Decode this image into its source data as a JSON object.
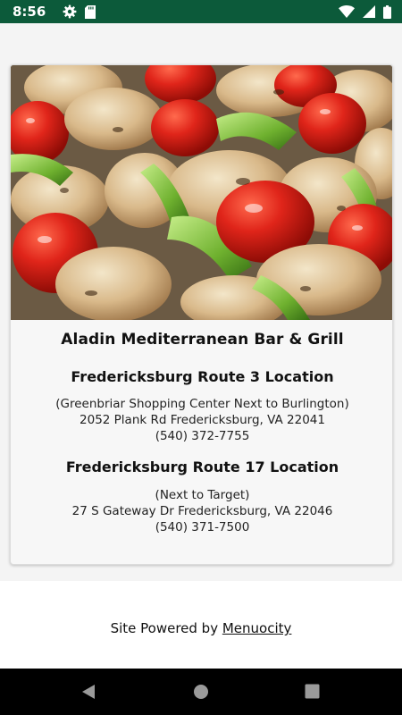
{
  "status_bar": {
    "time": "8:56",
    "left_icons": [
      "gear-icon",
      "sd-card-icon"
    ],
    "right_icons": [
      "wifi-icon",
      "signal-icon",
      "battery-icon"
    ],
    "color": "#0c5a3a"
  },
  "card": {
    "image_icon": "food-skewer-photo",
    "restaurant_name": "Aladin Mediterranean Bar & Grill",
    "locations": [
      {
        "title": "Fredericksburg Route 3 Location",
        "note": "(Greenbriar Shopping Center Next to Burlington)",
        "address": "2052 Plank Rd Fredericksburg, VA 22041",
        "phone": "(540) 372-7755"
      },
      {
        "title": "Fredericksburg Route 17 Location",
        "note": "(Next to Target)",
        "address": "27 S Gateway Dr Fredericksburg, VA 22046",
        "phone": "(540) 371-7500"
      }
    ]
  },
  "footer": {
    "prefix": "Site Powered by ",
    "link_text": "Menuocity"
  },
  "nav_bar": {
    "buttons": [
      "back-icon",
      "home-icon",
      "recents-icon"
    ]
  }
}
